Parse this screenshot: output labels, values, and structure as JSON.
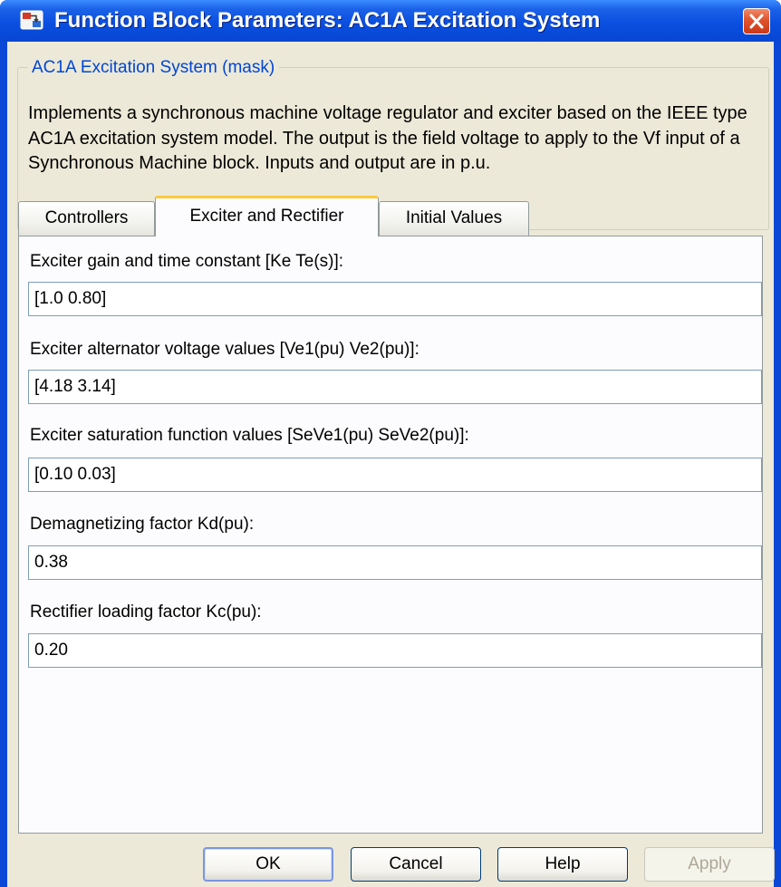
{
  "window": {
    "title": "Function Block Parameters: AC1A Excitation System",
    "icon": "simulink-block-icon",
    "close_icon": "close-icon"
  },
  "mask": {
    "legend": "AC1A Excitation System (mask)",
    "description": "Implements a synchronous machine voltage regulator and exciter based on the IEEE type AC1A excitation system model. The output is the field voltage to apply to the Vf input of a Synchronous Machine block. Inputs and output are in p.u."
  },
  "tabs": [
    {
      "label": "Controllers",
      "active": false
    },
    {
      "label": "Exciter and Rectifier",
      "active": true
    },
    {
      "label": "Initial Values",
      "active": false
    }
  ],
  "fields": [
    {
      "label": "Exciter gain and time constant [Ke Te(s)]:",
      "value": "[1.0 0.80]"
    },
    {
      "label": "Exciter alternator voltage values [Ve1(pu) Ve2(pu)]:",
      "value": "[4.18 3.14]"
    },
    {
      "label": "Exciter saturation function values [SeVe1(pu) SeVe2(pu)]:",
      "value": "[0.10 0.03]"
    },
    {
      "label": "Demagnetizing factor Kd(pu):",
      "value": "0.38"
    },
    {
      "label": "Rectifier loading factor Kc(pu):",
      "value": "0.20"
    }
  ],
  "buttons": {
    "ok": "OK",
    "cancel": "Cancel",
    "help": "Help",
    "apply": "Apply"
  },
  "colors": {
    "titlebar": "#0a4fe0",
    "legend_text": "#0046d5",
    "active_tab_accent": "#ffc83c",
    "dialog_face": "#ece9d8"
  }
}
